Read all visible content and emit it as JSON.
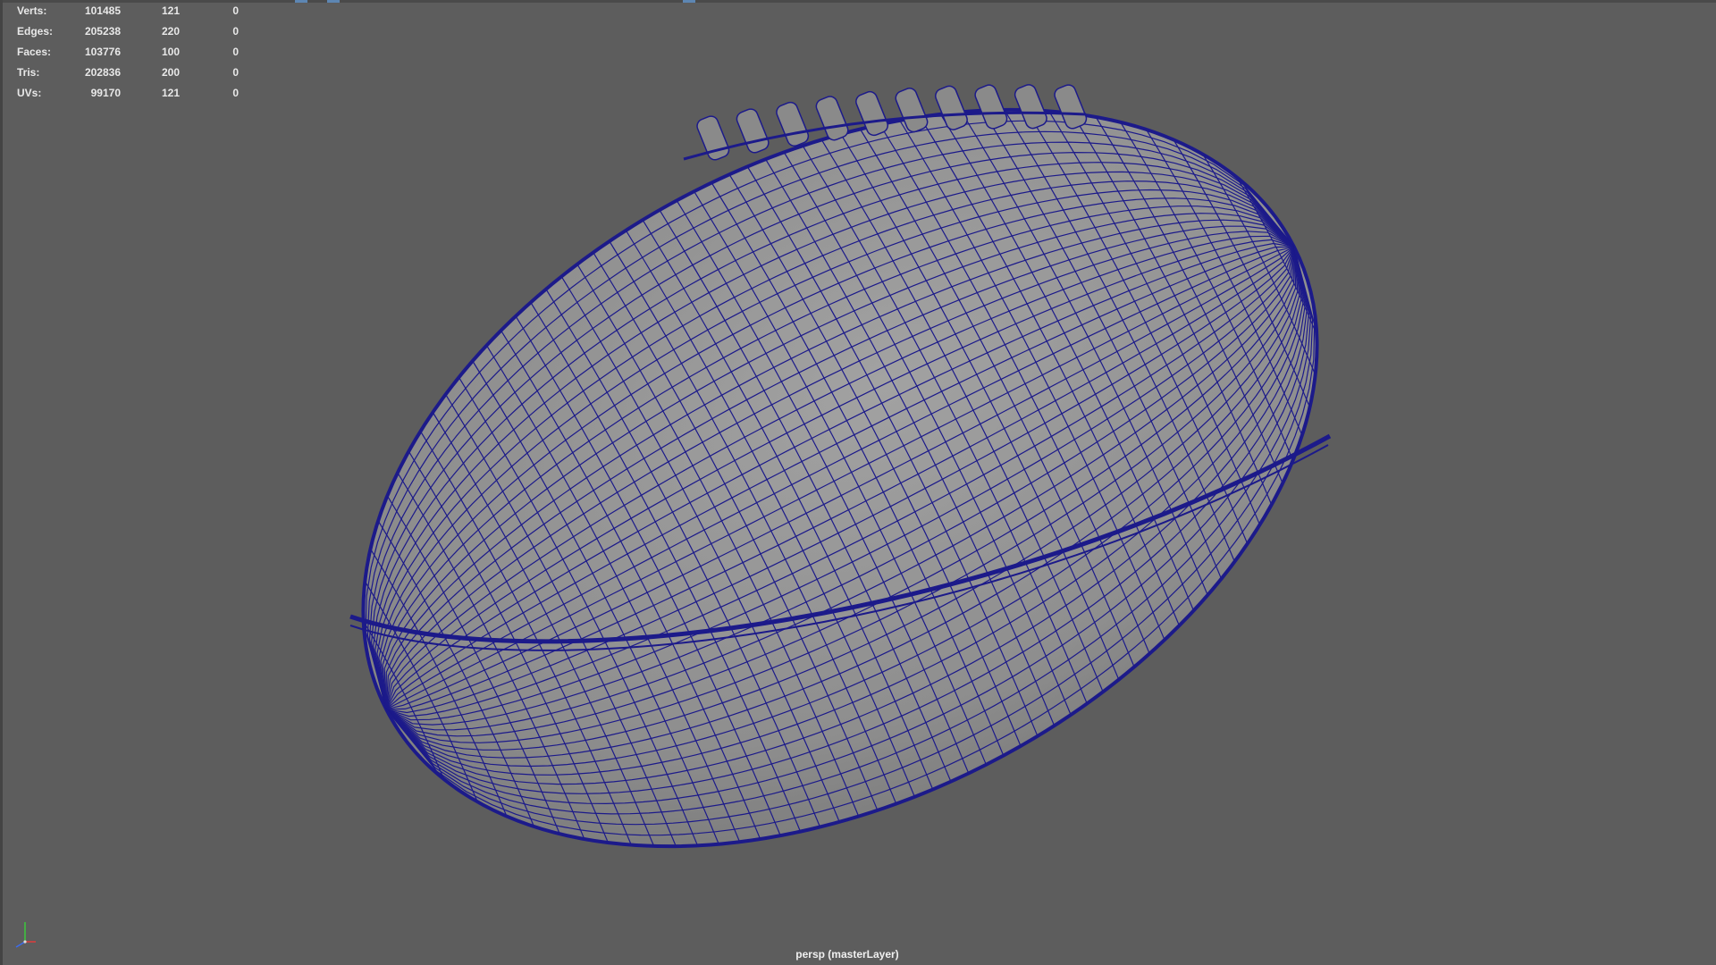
{
  "hud": {
    "rows": [
      {
        "label": "Verts:",
        "total": "101485",
        "selected": "121",
        "component": "0"
      },
      {
        "label": "Edges:",
        "total": "205238",
        "selected": "220",
        "component": "0"
      },
      {
        "label": "Faces:",
        "total": "103776",
        "selected": "100",
        "component": "0"
      },
      {
        "label": "Tris:",
        "total": "202836",
        "selected": "200",
        "component": "0"
      },
      {
        "label": "UVs:",
        "total": "99170",
        "selected": "121",
        "component": "0"
      }
    ]
  },
  "viewport": {
    "camera_label": "persp (masterLayer)",
    "background_color": "#5d5d5d",
    "wireframe_color": "#1c1a8a",
    "model_fill_color": "#8e8e8e"
  },
  "axis_gizmo": {
    "icon": "axis-gizmo-icon",
    "x_color": "#e03c3c",
    "y_color": "#3cc83c",
    "z_color": "#3c6cf0"
  }
}
